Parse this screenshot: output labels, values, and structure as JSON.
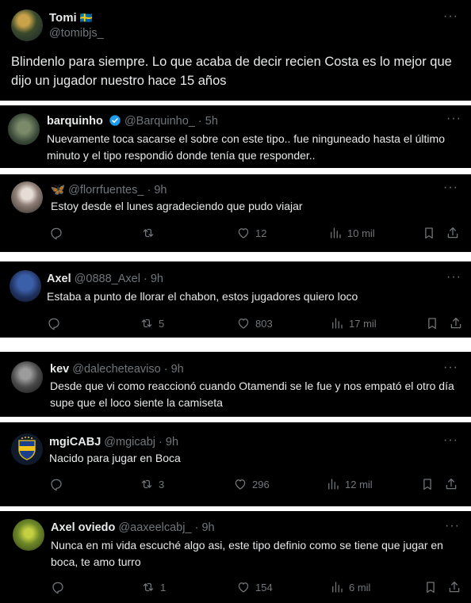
{
  "main_tweet": {
    "name": "Tomi",
    "flag": "🇸🇪",
    "handle": "@tomibjs_",
    "more": "···",
    "text": "Blindenlo para siempre. Lo que acaba de decir recien Costa es lo mejor que dijo un jugador nuestro hace 15 años"
  },
  "replies": [
    {
      "name": "barquinho",
      "verified": true,
      "handle": "@Barquinho_",
      "sep": "·",
      "time": "5h",
      "more": "···",
      "text": "Nuevamente toca sacarse el sobre con este tipo.. fue ninguneado hasta el último minuto y el tipo respondió donde tenía que responder.."
    },
    {
      "name": "🦋",
      "handle": "@florrfuentes_",
      "sep": "·",
      "time": "9h",
      "more": "···",
      "text": "Estoy desde el lunes agradeciendo que pudo viajar",
      "replies_count": "",
      "retweets": "",
      "likes": "12",
      "views": "10 mil"
    },
    {
      "name": "Axel",
      "handle": "@0888_Axel",
      "sep": "·",
      "time": "9h",
      "more": "···",
      "text": "Estaba a punto de llorar el chabon, estos jugadores quiero loco",
      "replies_count": "",
      "retweets": "5",
      "likes": "803",
      "views": "17 mil"
    },
    {
      "name": "kev",
      "handle": "@dalecheteaviso",
      "sep": "·",
      "time": "9h",
      "more": "···",
      "text": "Desde que vi como reaccionó cuando Otamendi se le fue y nos empató el otro día supe que el loco siente la camiseta"
    },
    {
      "name": "mgiCABJ",
      "handle": "@mgicabj",
      "sep": "·",
      "time": "9h",
      "more": "···",
      "text": "Nacido para jugar en Boca",
      "replies_count": "",
      "retweets": "3",
      "likes": "296",
      "views": "12 mil"
    },
    {
      "name": "Axel oviedo",
      "handle": "@aaxeelcabj_",
      "sep": "·",
      "time": "9h",
      "more": "···",
      "text": "Nunca en mi vida escuché algo asi, este tipo definio como se tiene que jugar en boca, te amo turro",
      "replies_count": "",
      "retweets": "1",
      "likes": "154",
      "views": "6 mil"
    }
  ],
  "icons": {
    "reply": "reply-icon",
    "retweet": "retweet-icon",
    "like": "heart-icon",
    "views": "views-icon",
    "bookmark": "bookmark-icon",
    "share": "share-icon"
  },
  "colors": {
    "background": "#000000",
    "text": "#e7e9ea",
    "muted": "#71767b",
    "verified": "#1d9bf0",
    "separator": "#ffffff"
  }
}
